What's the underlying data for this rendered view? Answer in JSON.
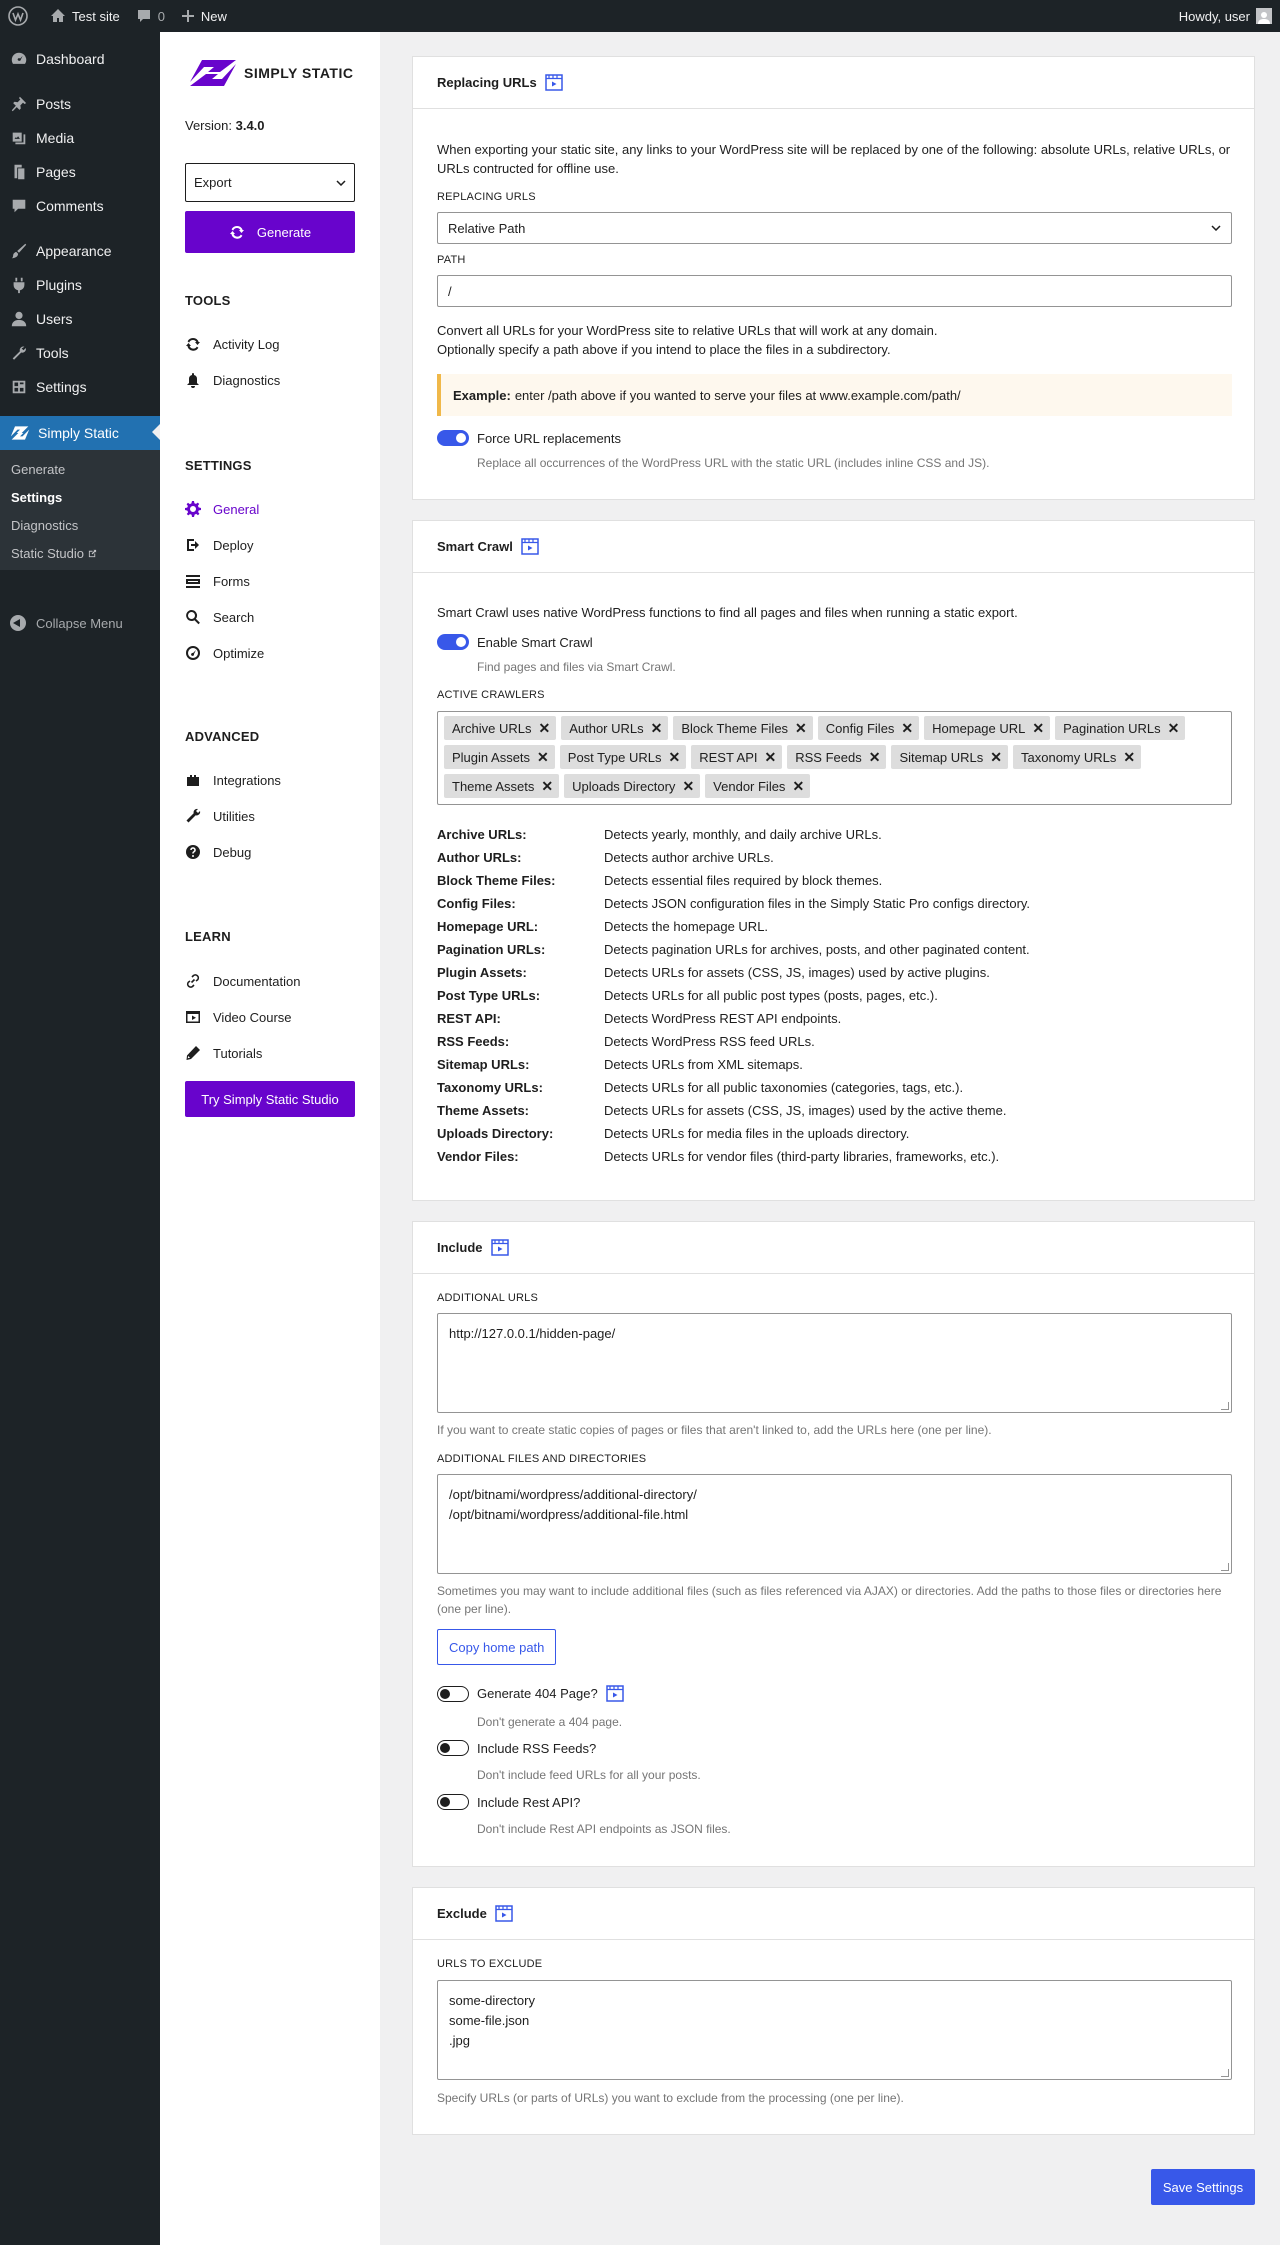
{
  "adminbar": {
    "site_name": "Test site",
    "comments_count": "0",
    "new_label": "New",
    "howdy": "Howdy, user"
  },
  "wpmenu": {
    "items": [
      {
        "label": "Dashboard",
        "icon": "dashboard-icon"
      },
      {
        "label": "Posts",
        "icon": "pin-icon"
      },
      {
        "label": "Media",
        "icon": "media-icon"
      },
      {
        "label": "Pages",
        "icon": "page-icon"
      },
      {
        "label": "Comments",
        "icon": "comment-icon"
      },
      {
        "label": "Appearance",
        "icon": "brush-icon"
      },
      {
        "label": "Plugins",
        "icon": "plug-icon"
      },
      {
        "label": "Users",
        "icon": "user-icon"
      },
      {
        "label": "Tools",
        "icon": "wrench-icon"
      },
      {
        "label": "Settings",
        "icon": "settings-icon"
      },
      {
        "label": "Simply Static",
        "icon": "simply-static-icon"
      }
    ],
    "submenu": [
      "Generate",
      "Settings",
      "Diagnostics",
      "Static Studio"
    ],
    "collapse": "Collapse Menu"
  },
  "ssnav": {
    "logo_text": "SIMPLY STATIC",
    "version_label": "Version:",
    "version_value": "3.4.0",
    "export_select": "Export",
    "generate": "Generate",
    "tools_heading": "TOOLS",
    "tools": [
      {
        "label": "Activity Log",
        "icon": "refresh-icon"
      },
      {
        "label": "Diagnostics",
        "icon": "bell-icon"
      }
    ],
    "settings_heading": "SETTINGS",
    "settings": [
      {
        "label": "General",
        "icon": "gear-icon"
      },
      {
        "label": "Deploy",
        "icon": "export-icon"
      },
      {
        "label": "Forms",
        "icon": "form-icon"
      },
      {
        "label": "Search",
        "icon": "search-icon"
      },
      {
        "label": "Optimize",
        "icon": "gauge-icon"
      }
    ],
    "advanced_heading": "ADVANCED",
    "advanced": [
      {
        "label": "Integrations",
        "icon": "plugin-icon"
      },
      {
        "label": "Utilities",
        "icon": "wrench-icon"
      },
      {
        "label": "Debug",
        "icon": "help-icon"
      }
    ],
    "learn_heading": "LEARN",
    "learn": [
      {
        "label": "Documentation",
        "icon": "link-icon"
      },
      {
        "label": "Video Course",
        "icon": "video-icon"
      },
      {
        "label": "Tutorials",
        "icon": "pencil-icon"
      }
    ],
    "try_button": "Try Simply Static Studio"
  },
  "replacing": {
    "title": "Replacing URLs",
    "intro_1": "When exporting your static site, any links to your WordPress site will be replaced by one of the following: absolute URLs, relative URLs, or",
    "intro_2": "URLs contructed for offline use.",
    "label_replacing": "REPLACING URLS",
    "select_value": "Relative Path",
    "label_path": "PATH",
    "path_value": "/",
    "desc_1": "Convert all URLs for your WordPress site to relative URLs that will work at any domain.",
    "desc_2": "Optionally specify a path above if you intend to place the files in a subdirectory.",
    "example_bold": "Example:",
    "example_text": "enter /path above if you wanted to serve your files at www.example.com/path/",
    "force_label": "Force URL replacements",
    "force_hint": "Replace all occurrences of the WordPress URL with the static URL (includes inline CSS and JS)."
  },
  "smart_crawl": {
    "title": "Smart Crawl",
    "intro": "Smart Crawl uses native WordPress functions to find all pages and files when running a static export.",
    "enable_label": "Enable Smart Crawl",
    "enable_hint": "Find pages and files via Smart Crawl.",
    "label_active": "ACTIVE CRAWLERS",
    "tokens_row1": [
      "Archive URLs",
      "Author URLs",
      "Block Theme Files",
      "Config Files",
      "Homepage URL",
      "Pagination URLs"
    ],
    "tokens_row2": [
      "Plugin Assets",
      "Post Type URLs",
      "REST API",
      "RSS Feeds",
      "Sitemap URLs",
      "Taxonomy URLs"
    ],
    "tokens_row3": [
      "Theme Assets",
      "Uploads Directory",
      "Vendor Files"
    ],
    "crawlers": [
      {
        "name": "Archive URLs:",
        "desc": "Detects yearly, monthly, and daily archive URLs."
      },
      {
        "name": "Author URLs:",
        "desc": "Detects author archive URLs."
      },
      {
        "name": "Block Theme Files:",
        "desc": "Detects essential files required by block themes."
      },
      {
        "name": "Config Files:",
        "desc": "Detects JSON configuration files in the Simply Static Pro configs directory."
      },
      {
        "name": "Homepage URL:",
        "desc": "Detects the homepage URL."
      },
      {
        "name": "Pagination URLs:",
        "desc": "Detects pagination URLs for archives, posts, and other paginated content."
      },
      {
        "name": "Plugin Assets:",
        "desc": "Detects URLs for assets (CSS, JS, images) used by active plugins."
      },
      {
        "name": "Post Type URLs:",
        "desc": "Detects URLs for all public post types (posts, pages, etc.)."
      },
      {
        "name": "REST API:",
        "desc": "Detects WordPress REST API endpoints."
      },
      {
        "name": "RSS Feeds:",
        "desc": "Detects WordPress RSS feed URLs."
      },
      {
        "name": "Sitemap URLs:",
        "desc": "Detects URLs from XML sitemaps."
      },
      {
        "name": "Taxonomy URLs:",
        "desc": "Detects URLs for all public taxonomies (categories, tags, etc.)."
      },
      {
        "name": "Theme Assets:",
        "desc": "Detects URLs for assets (CSS, JS, images) used by the active theme."
      },
      {
        "name": "Uploads Directory:",
        "desc": "Detects URLs for media files in the uploads directory."
      },
      {
        "name": "Vendor Files:",
        "desc": "Detects URLs for vendor files (third-party libraries, frameworks, etc.)."
      }
    ]
  },
  "include": {
    "title": "Include",
    "label_urls": "ADDITIONAL URLS",
    "urls_line1": "http://127.0.0.1/hidden-page/",
    "urls_hint": "If you want to create static copies of pages or files that aren't linked to, add the URLs here (one per line).",
    "label_files": "ADDITIONAL FILES AND DIRECTORIES",
    "files_line1": "/opt/bitnami/wordpress/additional-directory/",
    "files_line2": "/opt/bitnami/wordpress/additional-file.html",
    "files_hint_1": "Sometimes you may want to include additional files (such as files referenced via AJAX) or directories. Add the paths to those files or directories here",
    "files_hint_2": "(one per line).",
    "copy_button": "Copy home path",
    "gen404_label": "Generate 404 Page?",
    "gen404_hint": "Don't generate a 404 page.",
    "rss_label": "Include RSS Feeds?",
    "rss_hint": "Don't include feed URLs for all your posts.",
    "rest_label": "Include Rest API?",
    "rest_hint": "Don't include Rest API endpoints as JSON files."
  },
  "exclude": {
    "title": "Exclude",
    "label_urls": "URLS TO EXCLUDE",
    "line1": "some-directory",
    "line2": "some-file.json",
    "line3": ".jpg",
    "hint": "Specify URLs (or parts of URLs) you want to exclude from the processing (one per line)."
  },
  "save_button": "Save Settings",
  "colors": {
    "accent": "#6804cc",
    "primary": "#3858e9",
    "wp_blue": "#2271b1",
    "admin_dark": "#1d2327"
  }
}
